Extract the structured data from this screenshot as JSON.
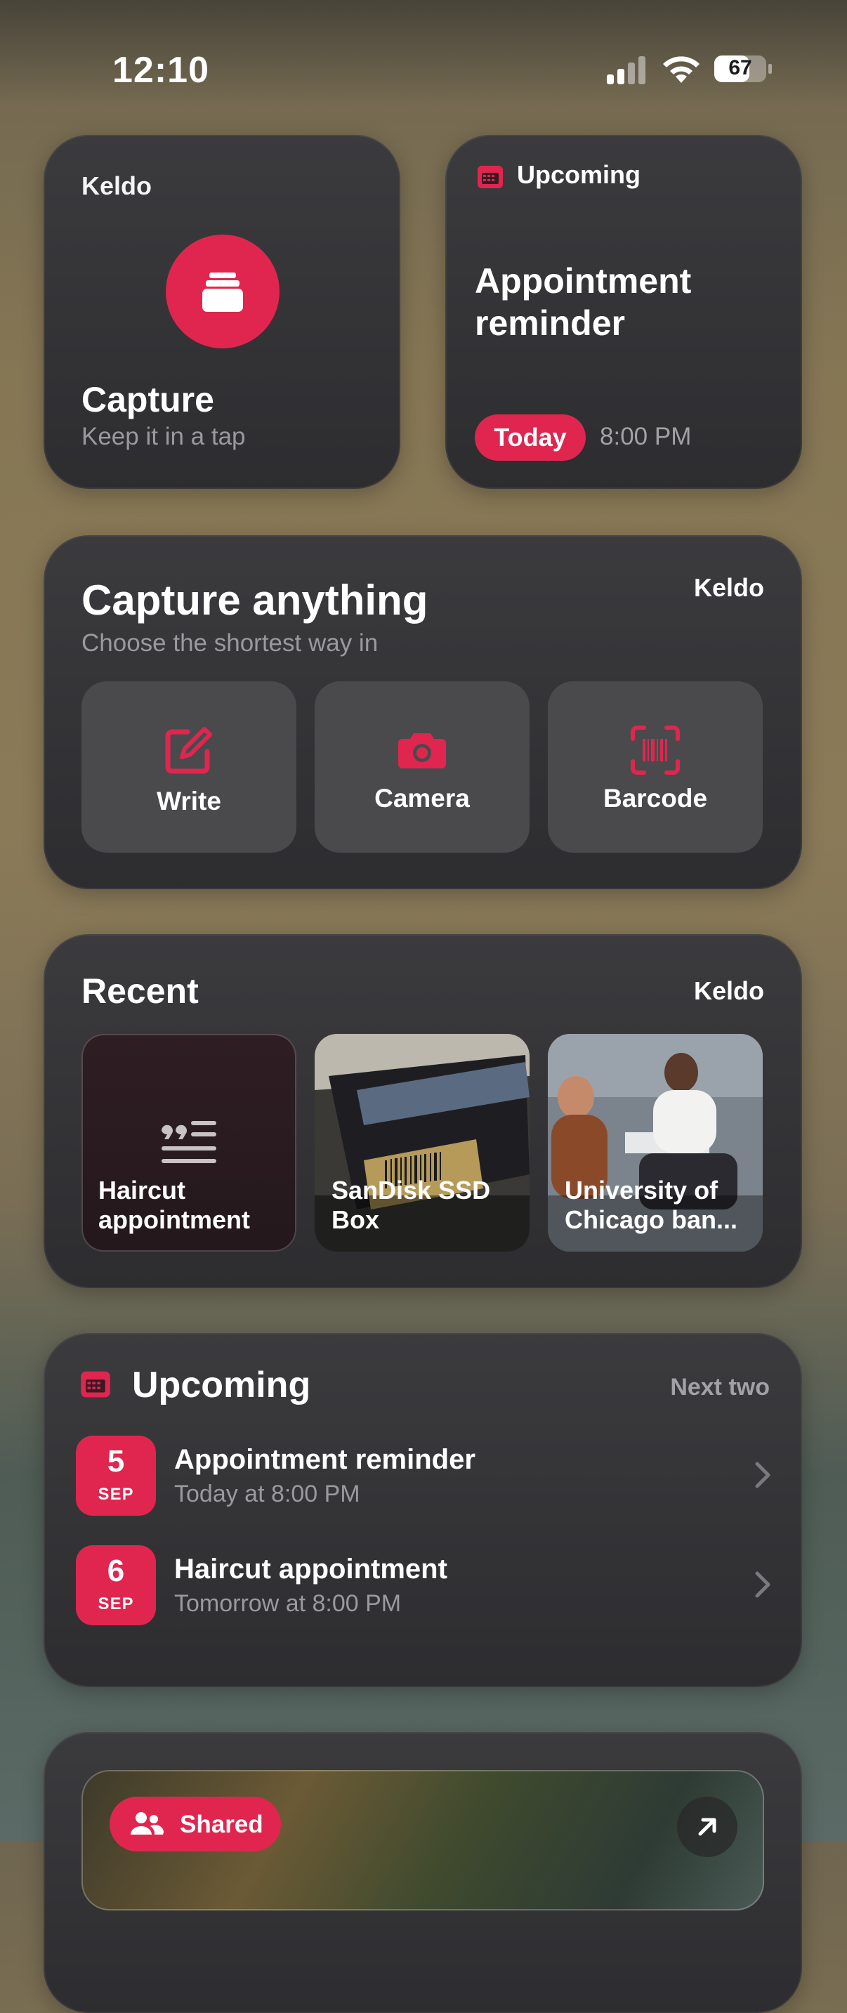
{
  "status_bar": {
    "time": "12:10",
    "battery": "67"
  },
  "widget_capture": {
    "brand": "Keldo",
    "title": "Capture",
    "subtitle": "Keep it in a tap"
  },
  "widget_upcoming_small": {
    "label": "Upcoming",
    "title": "Appointment reminder",
    "badge": "Today",
    "time": "8:00 PM"
  },
  "capture_anything": {
    "title": "Capture anything",
    "subtitle": "Choose the shortest way in",
    "brand": "Keldo",
    "actions": [
      {
        "label": "Write",
        "icon": "pencil-square-icon"
      },
      {
        "label": "Camera",
        "icon": "camera-icon"
      },
      {
        "label": "Barcode",
        "icon": "barcode-scan-icon"
      }
    ]
  },
  "recent": {
    "title": "Recent",
    "brand": "Keldo",
    "items": [
      {
        "label": "Haircut appointment",
        "icon": "quote-note-icon"
      },
      {
        "label": "SanDisk SSD Box"
      },
      {
        "label": "University of Chicago ban..."
      }
    ]
  },
  "upcoming": {
    "title": "Upcoming",
    "meta": "Next two",
    "events": [
      {
        "day": "5",
        "month": "SEP",
        "title": "Appointment reminder",
        "when": "Today at 8:00 PM"
      },
      {
        "day": "6",
        "month": "SEP",
        "title": "Haircut appointment",
        "when": "Tomorrow at 8:00 PM"
      }
    ]
  },
  "shared_widget": {
    "badge": "Shared",
    "icon": "people-icon",
    "action_icon": "arrow-up-right-icon"
  },
  "colors": {
    "accent": "#e0264f",
    "card": "#333336",
    "muted": "#9a9a9e"
  }
}
